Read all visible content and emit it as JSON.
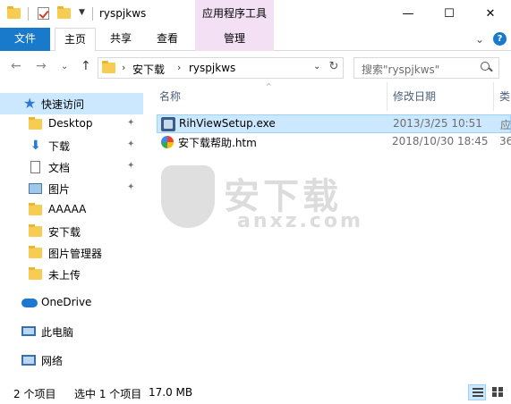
{
  "window": {
    "title": "ryspjkws",
    "context_tab_group": "应用程序工具",
    "controls": {
      "minimize": "—",
      "maximize": "☐",
      "close": "✕"
    }
  },
  "ribbon": {
    "tabs": [
      {
        "label": "文件"
      },
      {
        "label": "主页"
      },
      {
        "label": "共享"
      },
      {
        "label": "查看"
      },
      {
        "label": "管理"
      }
    ],
    "collapse_glyph": "⌄",
    "help_glyph": "?"
  },
  "navigation": {
    "back": "←",
    "forward": "→",
    "recent": "⌄",
    "up": "↑",
    "path": [
      "安下载",
      "ryspjkws"
    ],
    "refresh": "↻",
    "search_placeholder": "搜索\"ryspjkws\""
  },
  "nav_pane": {
    "quick_access": "快速访问",
    "items": [
      {
        "label": "Desktop",
        "pinned": true,
        "icon": "folder-icon"
      },
      {
        "label": "下载",
        "pinned": true,
        "icon": "download-icon"
      },
      {
        "label": "文档",
        "pinned": true,
        "icon": "document-icon"
      },
      {
        "label": "图片",
        "pinned": true,
        "icon": "pictures-icon"
      },
      {
        "label": "AAAAA",
        "pinned": false,
        "icon": "folder-icon"
      },
      {
        "label": "安下载",
        "pinned": false,
        "icon": "folder-icon"
      },
      {
        "label": "图片管理器",
        "pinned": false,
        "icon": "folder-icon"
      },
      {
        "label": "未上传",
        "pinned": false,
        "icon": "folder-icon"
      }
    ],
    "onedrive": "OneDrive",
    "this_pc": "此电脑",
    "network": "网络",
    "pin_glyph": "📌"
  },
  "file_list": {
    "columns": [
      "名称",
      "修改日期",
      "类型"
    ],
    "column_type_visible": "类",
    "files": [
      {
        "name": "RihViewSetup.exe",
        "date": "2013/3/25 10:51",
        "type": "应",
        "icon": "exe-icon",
        "selected": true
      },
      {
        "name": "安下载帮助.htm",
        "date": "2018/10/30 18:45",
        "type": "36",
        "icon": "htm-icon",
        "selected": false
      }
    ]
  },
  "watermark": {
    "text_cn": "安下载",
    "text_en": "anxz.com"
  },
  "status_bar": {
    "item_count": "2 个项目",
    "selection": "选中 1 个项目",
    "size": "17.0 MB"
  },
  "colors": {
    "accent": "#1979ca",
    "selection": "#cce8ff",
    "context_tab": "#f4e0f5"
  }
}
